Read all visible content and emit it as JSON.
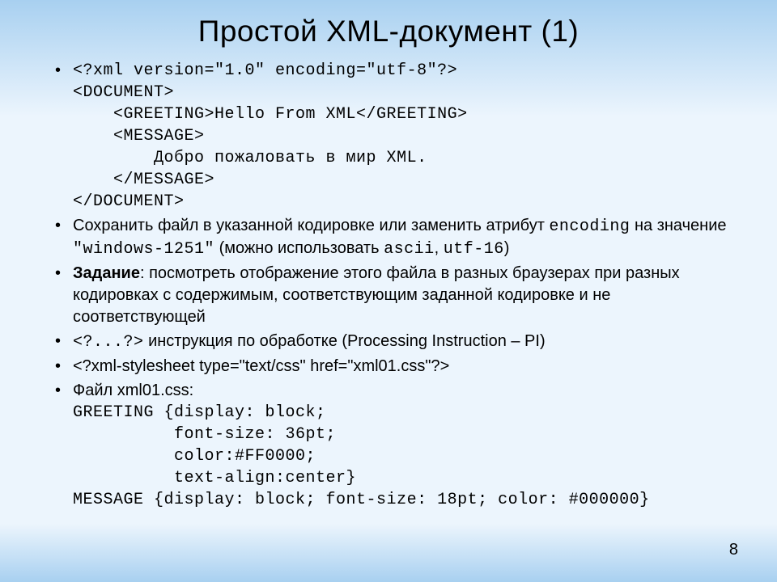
{
  "title": "Простой XML-документ (1)",
  "page_number": "8",
  "bullets": {
    "b0": {
      "code": "<?xml version=\"1.0\" encoding=\"utf-8\"?>\n<DOCUMENT>\n    <GREETING>Hello From XML</GREETING>\n    <MESSAGE>\n        Добро пожаловать в мир XML.\n    </MESSAGE>\n</DOCUMENT>"
    },
    "b1": {
      "pre1": "Сохранить файл в указанной кодировке или заменить атрибут ",
      "enc": "encoding",
      "pre2": " на значение ",
      "val": "\"windows-1251\"",
      "mid": " (можно использовать ",
      "alt1": "ascii",
      "sep": ", ",
      "alt2": "utf-16",
      "tail": ")"
    },
    "b2": {
      "label": "Задание",
      "text": ": посмотреть отображение этого файла в разных браузерах при разных кодировках с содержимым, соответствующим заданной кодировке и не соответствующей"
    },
    "b3": {
      "pi": "<?...?>",
      "text": " инструкция по обработке (Processing Instruction – PI)"
    },
    "b4": {
      "text": "<?xml-stylesheet type=\"text/css\" href=\"xml01.css\"?>"
    },
    "b5": {
      "label": "Файл xml01.css:",
      "css": "GREETING {display: block;\n          font-size: 36pt;\n          color:#FF0000;\n          text-align:center}\nMESSAGE {display: block; font-size: 18pt; color: #000000}"
    }
  }
}
